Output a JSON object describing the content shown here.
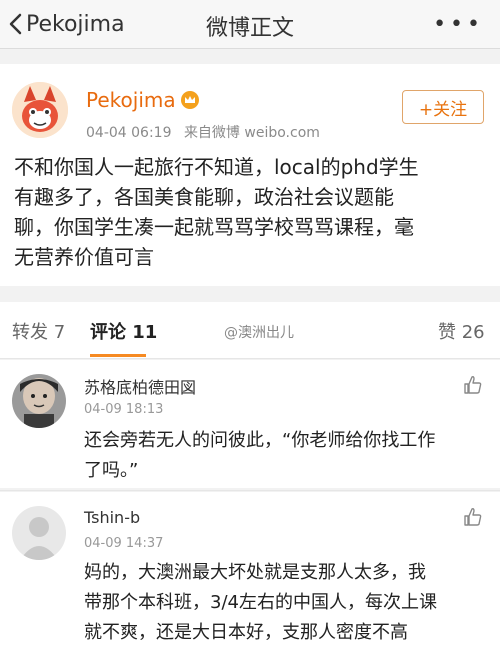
{
  "nav": {
    "back_label": "Pekojima",
    "title": "微博正文",
    "more_label": "•••"
  },
  "post": {
    "username": "Pekojima",
    "date": "04-04 06:19",
    "source": "来自微博 weibo.com",
    "follow_label": "+关注",
    "text_lines": [
      "不和你国人一起旅行不知道，local的phd学生",
      "有趣多了，各国美食能聊，政治社会议题能",
      "聊，你国学生凑一起就骂骂学校骂骂课程，毫",
      "无营养价值可言"
    ]
  },
  "tabs": {
    "repost": "转发 7",
    "comments": "评论 11",
    "likes": "赞 26",
    "watermark": "@澳洲出儿"
  },
  "comments": [
    {
      "name": "苏格底柏德田図",
      "time": "04-09 18:13",
      "text_lines": [
        "还会旁若无人的问彼此，“你老师给你找工作",
        "了吗。”"
      ]
    },
    {
      "name": "Tshin-b",
      "time": "04-09 14:37",
      "text_lines": [
        "妈的，大澳洲最大坏处就是支那人太多，我",
        "带那个本科班，3/4左右的中国人，每次上课",
        "就不爽，还是大日本好，支那人密度不高"
      ]
    }
  ],
  "colors": {
    "accent": "#e8730f",
    "username": "#e86b0f",
    "tab_underline": "#f68a22"
  }
}
